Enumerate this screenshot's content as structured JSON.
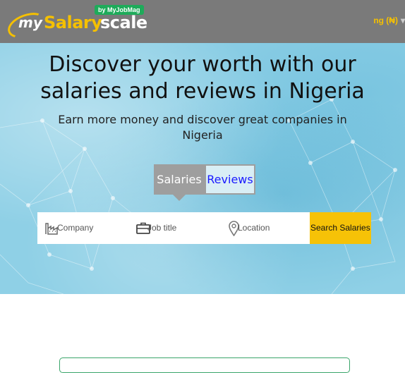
{
  "header": {
    "logo": {
      "my": "my",
      "salary": "Salary",
      "scale": "scale",
      "badge": "by MyJobMag"
    },
    "currency": "ng (₦)"
  },
  "hero": {
    "title_line1": "Discover your worth with our",
    "title_line2": "salaries and reviews in Nigeria",
    "subtitle_line1": "Earn more money and discover great companies in",
    "subtitle_line2": "Nigeria"
  },
  "tabs": {
    "salaries": "Salaries",
    "reviews": "Reviews",
    "active": "salaries"
  },
  "search": {
    "company_placeholder": "Company",
    "job_placeholder": "Job title",
    "location_placeholder": "Location",
    "button": "Search Salaries"
  },
  "colors": {
    "header_bg": "#7a7a7a",
    "brand_yellow": "#f5c000",
    "button_yellow": "#f6c207",
    "badge_green": "#1eab5a",
    "tab_gray": "#9e9e9e",
    "link_blue": "#1a1aff"
  },
  "icons": {
    "company": "factory-icon",
    "job": "briefcase-icon",
    "location": "map-pin-icon",
    "currency_caret": "chevron-down-icon"
  }
}
